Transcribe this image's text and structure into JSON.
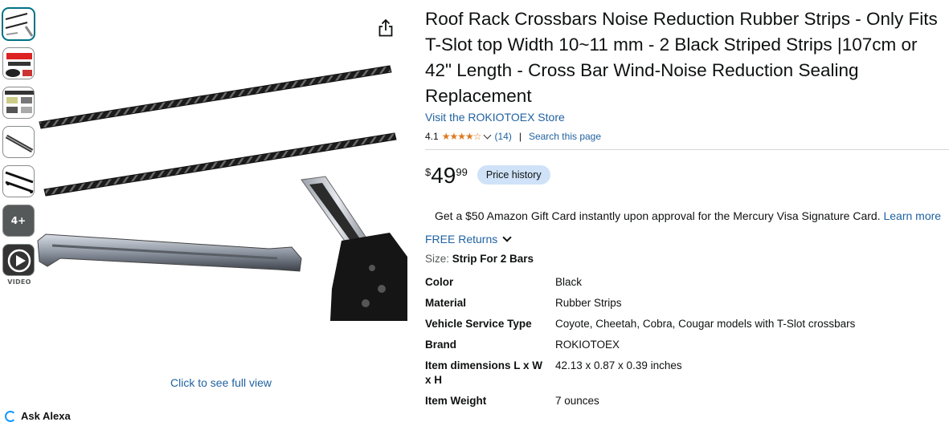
{
  "thumbnails": {
    "more_label": "4+",
    "video_label": "VIDEO"
  },
  "gallery": {
    "full_view_label": "Click to see full view",
    "ask_alexa_label": "Ask Alexa"
  },
  "product": {
    "title": "Roof Rack Crossbars Noise Reduction Rubber Strips - Only Fits T-Slot top Width 10~11 mm - 2 Black Striped Strips |107cm or 42\" Length - Cross Bar Wind-Noise Reduction Sealing Replacement",
    "store_link": "Visit the ROKIOTOEX Store",
    "rating": "4.1",
    "stars": "★★★★☆",
    "rating_count": "(14)",
    "separator": "|",
    "search_page": "Search this page",
    "price": {
      "symbol": "$",
      "whole": "49",
      "fraction": "99"
    },
    "price_history_label": "Price history",
    "gift_text": "Get a $50 Amazon Gift Card instantly upon approval for the Mercury Visa Signature Card.",
    "gift_link": "Learn more",
    "returns_label": "FREE Returns",
    "size_key": "Size:",
    "size_value": "Strip For 2 Bars",
    "specs": [
      {
        "key": "Color",
        "value": "Black"
      },
      {
        "key": "Material",
        "value": "Rubber Strips"
      },
      {
        "key": "Vehicle Service Type",
        "value": "Coyote, Cheetah, Cobra, Cougar models with T-Slot crossbars"
      },
      {
        "key": "Brand",
        "value": "ROKIOTOEX"
      },
      {
        "key": "Item dimensions L x W x H",
        "value": "42.13 x 0.87 x 0.39 inches"
      },
      {
        "key": "Item Weight",
        "value": "7 ounces"
      }
    ]
  },
  "colors": {
    "link": "#2162a1",
    "star": "#de7921",
    "price_history_bg": "#cfe2f8",
    "active_thumb_border": "#007185"
  },
  "icons": {
    "share": "share-icon",
    "alexa": "alexa-icon",
    "play": "play-icon",
    "chevron": "chevron-down-icon"
  }
}
